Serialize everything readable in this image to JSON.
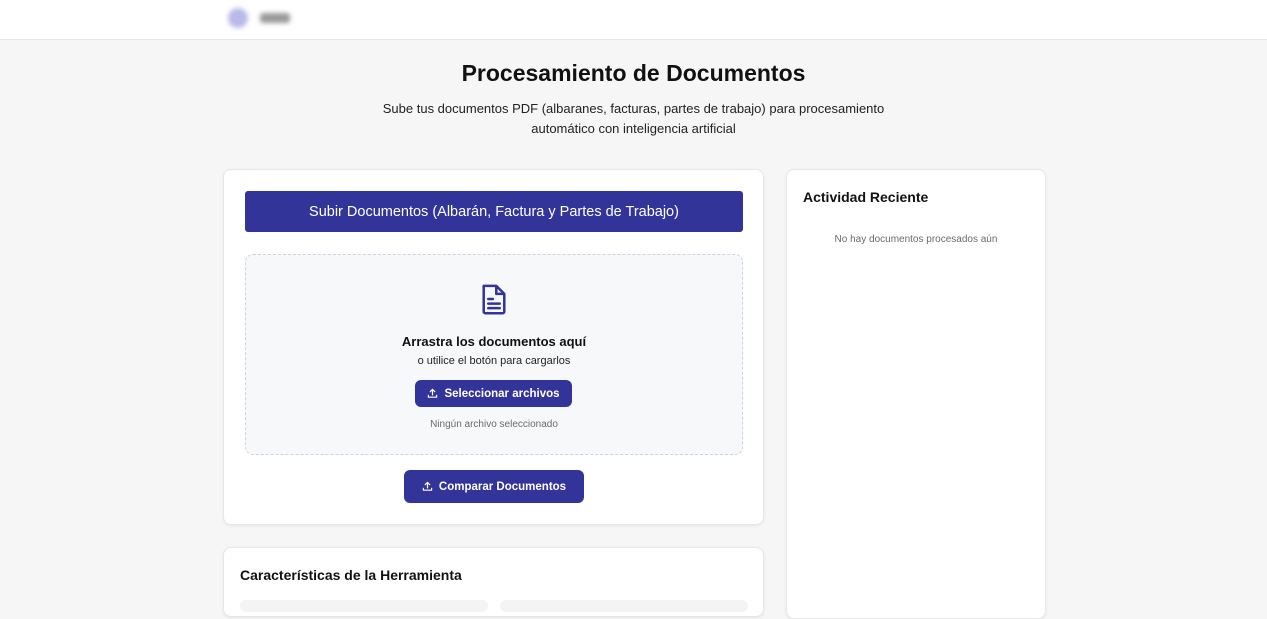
{
  "page": {
    "title": "Procesamiento de Documentos",
    "subtitle": "Sube tus documentos PDF (albaranes, facturas, partes de trabajo) para procesamiento automático con inteligencia artificial"
  },
  "upload": {
    "header_label": "Subir Documentos (Albarán, Factura y Partes de Trabajo)",
    "drop_title": "Arrastra los documentos aquí",
    "drop_hint": "o utilice el botón para cargarlos",
    "select_label": "Seleccionar archivos",
    "no_file": "Ningún archivo seleccionado",
    "compare_label": "Comparar Documentos"
  },
  "features": {
    "title": "Características de la Herramienta"
  },
  "activity": {
    "title": "Actividad Reciente",
    "empty": "No hay documentos procesados aún"
  },
  "icons": {
    "document": "file-text-icon",
    "upload": "upload-icon"
  },
  "colors": {
    "accent": "#33349a",
    "background": "#f6f6f6"
  }
}
